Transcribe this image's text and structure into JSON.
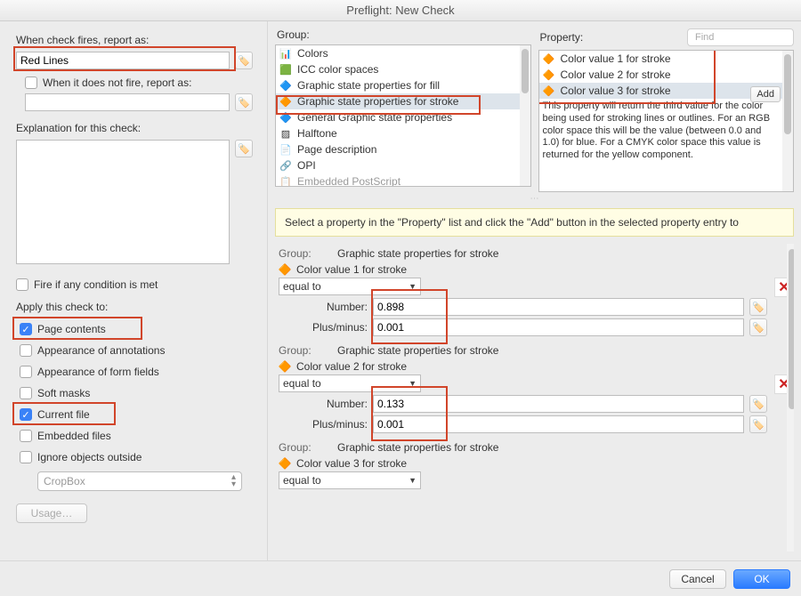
{
  "title": "Preflight: New Check",
  "left": {
    "report_as_label": "When check fires, report as:",
    "report_as_value": "Red Lines",
    "not_fire_label": "When it does not fire, report as:",
    "not_fire_value": "",
    "explanation_label": "Explanation for this check:",
    "explanation_value": "",
    "fire_any_label": "Fire if any condition is met",
    "apply_label": "Apply this check to:",
    "apply_options": [
      {
        "label": "Page contents",
        "checked": true
      },
      {
        "label": "Appearance of annotations",
        "checked": false
      },
      {
        "label": "Appearance of form fields",
        "checked": false
      },
      {
        "label": "Soft masks",
        "checked": false
      },
      {
        "label": "Current file",
        "checked": true
      },
      {
        "label": "Embedded files",
        "checked": false
      },
      {
        "label": "Ignore objects outside",
        "checked": false
      }
    ],
    "crop_sel": "CropBox",
    "usage_btn": "Usage…"
  },
  "group": {
    "label": "Group:",
    "items": [
      "Colors",
      "ICC color spaces",
      "Graphic state properties for fill",
      "Graphic state properties for stroke",
      "General Graphic state properties",
      "Halftone",
      "Page description",
      "OPI",
      "Embedded PostScript"
    ],
    "selected_index": 3
  },
  "property": {
    "label": "Property:",
    "find_placeholder": "Find",
    "items": [
      "Color value 1 for stroke",
      "Color value 2 for stroke",
      "Color value 3 for stroke"
    ],
    "selected_index": 2,
    "add_label": "Add",
    "description": "This property will return the third value for the color being used for stroking lines or outlines. For an RGB color space this will be the value (between 0.0 and 1.0) for blue. For a CMYK color space this value is returned for the yellow component."
  },
  "hint": "Select a property in the \"Property\" list and click the \"Add\" button in the selected property entry to",
  "cond_labels": {
    "group": "Group:",
    "number": "Number:",
    "plusminus": "Plus/minus:",
    "operator": "equal to"
  },
  "conditions": [
    {
      "group": "Graphic state properties for stroke",
      "prop": "Color value 1 for stroke",
      "number": "0.898",
      "pm": "0.001"
    },
    {
      "group": "Graphic state properties for stroke",
      "prop": "Color value 2 for stroke",
      "number": "0.133",
      "pm": "0.001"
    },
    {
      "group": "Graphic state properties for stroke",
      "prop": "Color value 3 for stroke",
      "number": "",
      "pm": ""
    }
  ],
  "footer": {
    "cancel": "Cancel",
    "ok": "OK"
  }
}
